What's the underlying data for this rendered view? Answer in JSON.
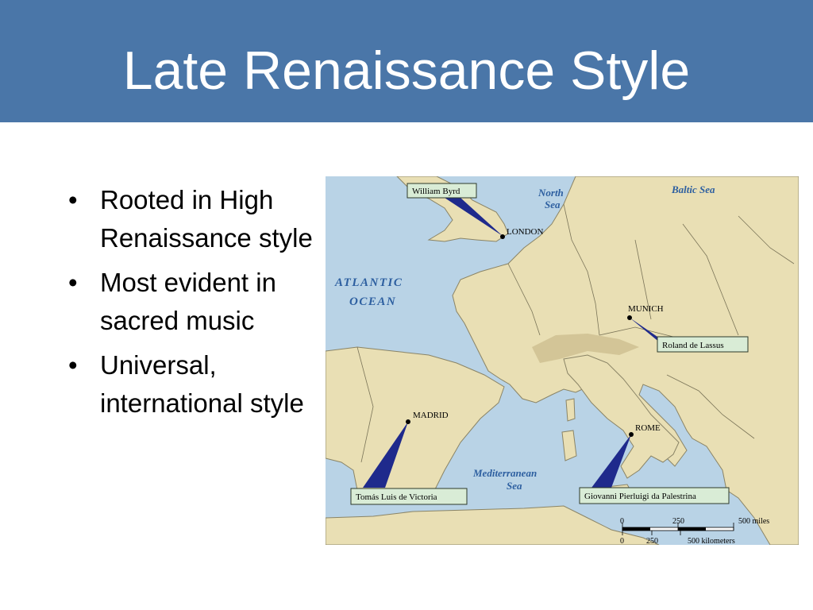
{
  "slide": {
    "title": "Late Renaissance Style",
    "bullets": [
      "Rooted in High Renaissance style",
      "Most evident in sacred music",
      "Universal, international style"
    ],
    "bullet_glyph": "•"
  },
  "map": {
    "seas": {
      "north_sea_1": "North",
      "north_sea_2": "Sea",
      "baltic": "Baltic Sea",
      "atlantic_1": "ATLANTIC",
      "atlantic_2": "OCEAN",
      "med_1": "Mediterranean",
      "med_2": "Sea"
    },
    "cities": {
      "london": "LONDON",
      "munich": "MUNICH",
      "madrid": "MADRID",
      "rome": "ROME"
    },
    "composers": {
      "byrd": "William Byrd",
      "lassus": "Roland de Lassus",
      "victoria": "Tomás Luis de Victoria",
      "palestrina": "Giovanni Pierluigi da Palestrina"
    },
    "scale": {
      "miles_0": "0",
      "miles_250": "250",
      "miles_500": "500 miles",
      "km_0": "0",
      "km_250": "250",
      "km_500": "500 kilometers"
    },
    "colors": {
      "water": "#b9d3e6",
      "land": "#e9dfb4",
      "label_box": "#d9ecd6",
      "pointer": "#1f2a8c",
      "sea_label": "#2d5fa0"
    }
  }
}
